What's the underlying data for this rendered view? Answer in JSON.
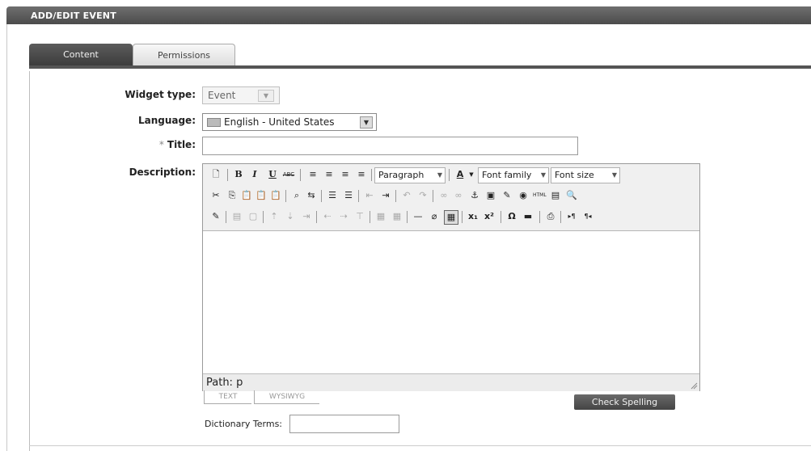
{
  "window": {
    "title": "ADD/EDIT EVENT"
  },
  "tabs": [
    {
      "label": "Content",
      "active": true
    },
    {
      "label": "Permissions",
      "active": false
    }
  ],
  "form": {
    "widget_type": {
      "label": "Widget type:",
      "value": "Event"
    },
    "language": {
      "label": "Language:",
      "value": "English - United States"
    },
    "title": {
      "label": "Title:",
      "required_marker": "*",
      "value": ""
    },
    "description": {
      "label": "Description:"
    }
  },
  "editor": {
    "row1": {
      "bold": "B",
      "italic": "I",
      "underline": "U",
      "strike": "ABC",
      "format_select": "Paragraph",
      "font_color": "A",
      "font_family": "Font family",
      "font_size": "Font size"
    },
    "row3_misc": {
      "hr": "—",
      "sub": "x₁",
      "sup": "x²",
      "omega": "Ω",
      "html": "HTML"
    },
    "path_label": "Path:",
    "path_value": "p",
    "mode_tabs": {
      "text": "TEXT",
      "wysiwyg": "WYSIWYG"
    },
    "spell_button": "Check Spelling"
  },
  "dictionary": {
    "label": "Dictionary Terms:",
    "value": ""
  },
  "colors": {
    "title_bar": "#555555",
    "tab_active": "#4a4a4a",
    "button": "#555555"
  }
}
